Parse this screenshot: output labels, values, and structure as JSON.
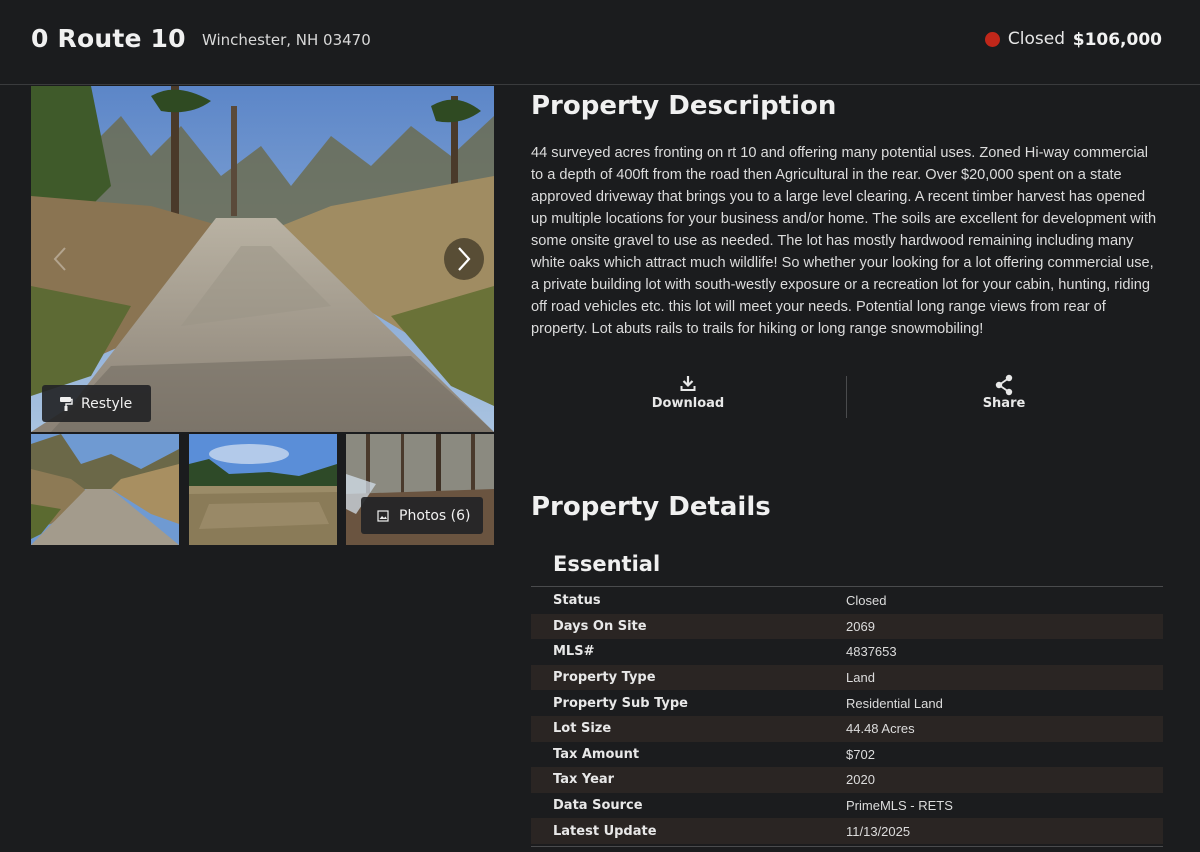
{
  "header": {
    "address": "0 Route 10",
    "city": "Winchester, NH 03470",
    "status": "Closed",
    "price": "$106,000",
    "status_color": "#c0271a"
  },
  "gallery": {
    "restyle_label": "Restyle",
    "photos_label": "Photos (6)",
    "icons": [
      "chevron-left-icon",
      "chevron-right-icon",
      "paint-roller-icon",
      "image-icon"
    ]
  },
  "description": {
    "title": "Property Description",
    "text": "44 surveyed acres fronting on rt 10 and offering many potential uses. Zoned Hi-way commercial to a depth of 400ft from the road then Agricultural in the rear. Over $20,000 spent on a state approved driveway that brings you to a large level clearing. A recent timber harvest has opened up multiple locations for your business and/or home. The soils are excellent for development with some onsite gravel to use as needed. The lot has mostly hardwood remaining including many white oaks which attract much wildlife! So whether your looking for a lot offering commercial use, a private building lot with south-westly exposure or a recreation lot for your cabin, hunting, riding off road vehicles etc. this lot will meet your needs. Potential long range views from rear of property. Lot abuts rails to trails for hiking or long range snowmobiling!"
  },
  "actions": {
    "download_label": "Download",
    "share_label": "Share"
  },
  "details": {
    "title": "Property Details",
    "section": "Essential",
    "rows": [
      {
        "label": "Status",
        "value": "Closed"
      },
      {
        "label": "Days On Site",
        "value": "2069"
      },
      {
        "label": "MLS#",
        "value": "4837653"
      },
      {
        "label": "Property Type",
        "value": "Land"
      },
      {
        "label": "Property Sub Type",
        "value": "Residential Land"
      },
      {
        "label": "Lot Size",
        "value": "44.48 Acres"
      },
      {
        "label": "Tax Amount",
        "value": "$702"
      },
      {
        "label": "Tax Year",
        "value": "2020"
      },
      {
        "label": "Data Source",
        "value": "PrimeMLS - RETS"
      },
      {
        "label": "Latest Update",
        "value": "11/13/2025"
      }
    ]
  }
}
